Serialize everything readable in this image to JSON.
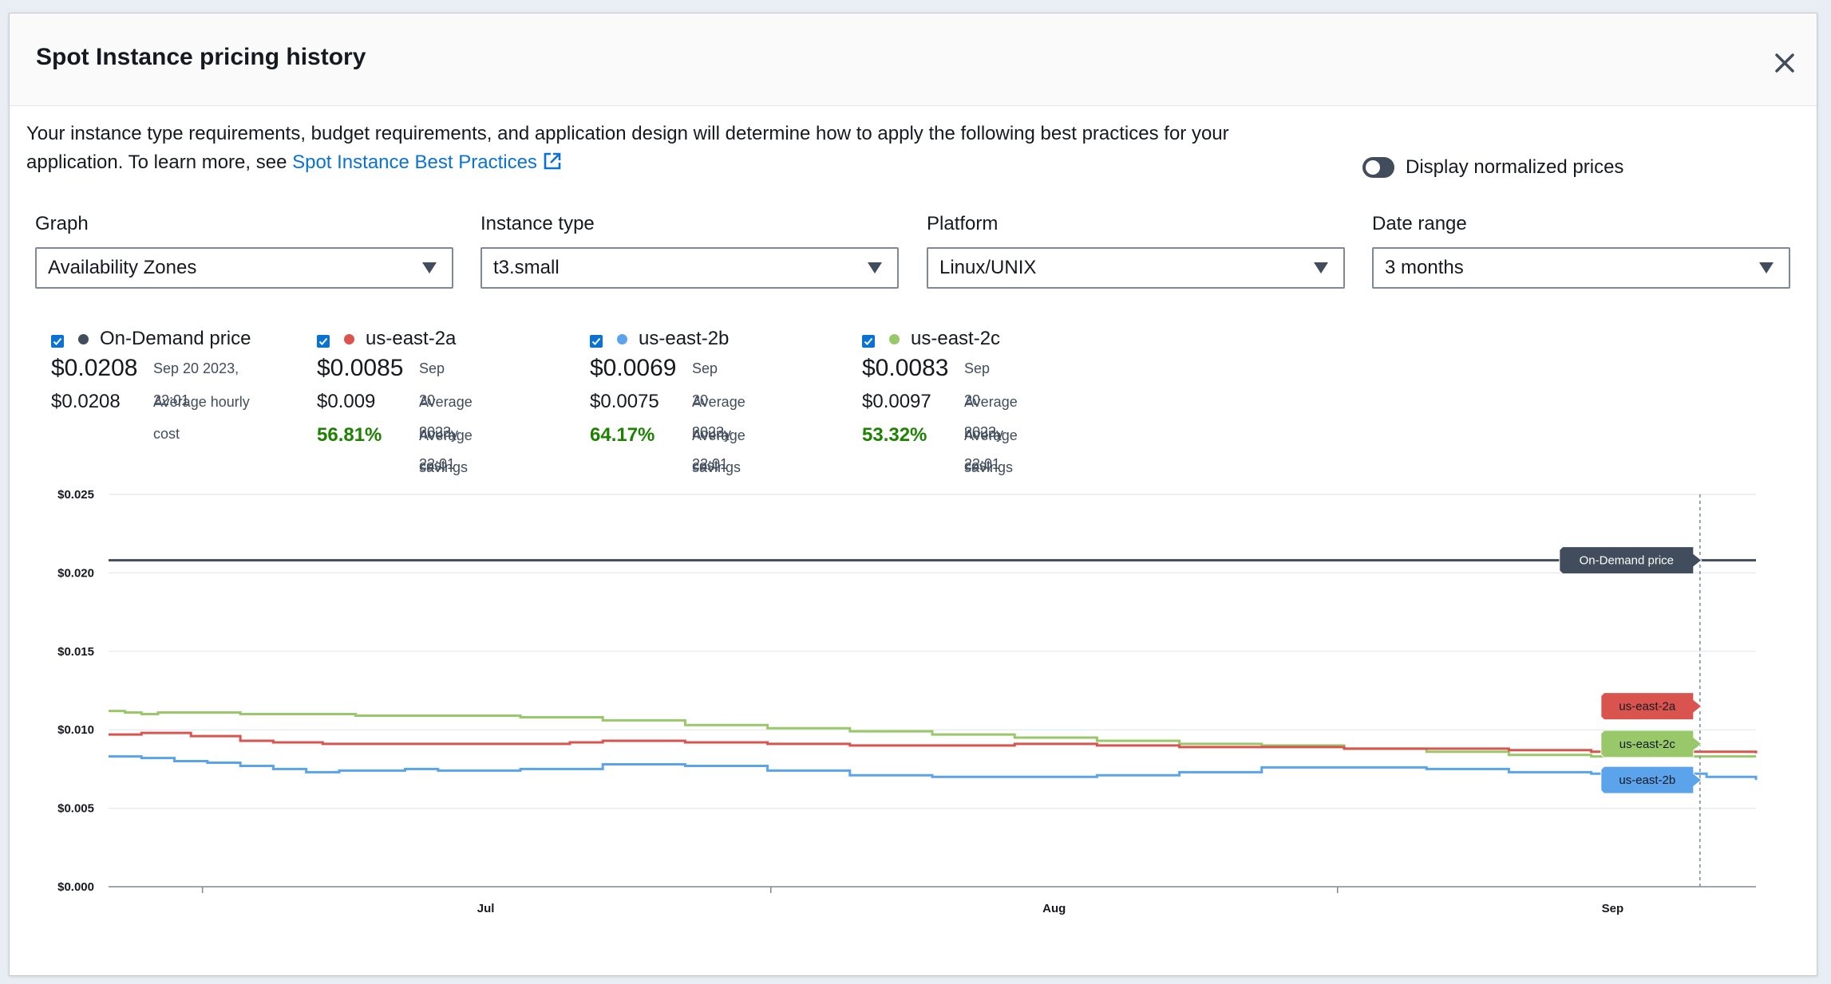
{
  "modal": {
    "title": "Spot Instance pricing history",
    "description": "Your instance type requirements, budget requirements, and application design will determine how to apply the following best practices for your application. To learn more, see ",
    "link_text": "Spot Instance Best Practices",
    "toggle_label": "Display normalized prices"
  },
  "filters": [
    {
      "label": "Graph",
      "value": "Availability Zones"
    },
    {
      "label": "Instance type",
      "value": "t3.small"
    },
    {
      "label": "Platform",
      "value": "Linux/UNIX"
    },
    {
      "label": "Date range",
      "value": "3 months"
    }
  ],
  "legend": [
    {
      "name": "On-Demand price",
      "color": "#414d5c",
      "current_price": "$0.0208",
      "timestamp": "Sep 20 2023, 22:01",
      "avg_cost": "$0.0208",
      "avg_cost_label": "Average hourly cost",
      "savings": "",
      "savings_label": ""
    },
    {
      "name": "us-east-2a",
      "color": "#d9534f",
      "current_price": "$0.0085",
      "timestamp": "Sep 20 2023, 22:01",
      "avg_cost": "$0.009",
      "avg_cost_label": "Average hourly cost",
      "savings": "56.81%",
      "savings_label": "Average savings"
    },
    {
      "name": "us-east-2b",
      "color": "#5ba3ea",
      "current_price": "$0.0069",
      "timestamp": "Sep 20 2023, 22:01",
      "avg_cost": "$0.0075",
      "avg_cost_label": "Average hourly cost",
      "savings": "64.17%",
      "savings_label": "Average savings"
    },
    {
      "name": "us-east-2c",
      "color": "#99c86a",
      "current_price": "$0.0083",
      "timestamp": "Sep 20 2023, 22:01",
      "avg_cost": "$0.0097",
      "avg_cost_label": "Average hourly cost",
      "savings": "53.32%",
      "savings_label": "Average savings"
    }
  ],
  "chart_data": {
    "type": "line",
    "ylim": [
      0,
      0.025
    ],
    "y_ticks": [
      0,
      0.005,
      0.01,
      0.015,
      0.02,
      0.025
    ],
    "y_tick_labels": [
      "$0.000",
      "$0.005",
      "$0.010",
      "$0.015",
      "$0.020",
      "$0.025"
    ],
    "x_tick_labels": [
      "Jul",
      "Aug",
      "Sep"
    ],
    "x_tick_positions": [
      0.229,
      0.574,
      0.913
    ],
    "x_minor_ticks": [
      0.057,
      0.402,
      0.746
    ],
    "grid": true,
    "hover_position": 0.966,
    "series": [
      {
        "name": "On-Demand price",
        "color": "#414d5c",
        "x": [
          0,
          1
        ],
        "y": [
          0.0208,
          0.0208
        ]
      },
      {
        "name": "us-east-2a",
        "color": "#d9534f",
        "x": [
          0,
          0.02,
          0.05,
          0.08,
          0.1,
          0.13,
          0.2,
          0.28,
          0.3,
          0.35,
          0.4,
          0.45,
          0.5,
          0.55,
          0.6,
          0.65,
          0.7,
          0.75,
          0.8,
          0.85,
          0.9,
          0.95,
          1
        ],
        "y": [
          0.0097,
          0.0098,
          0.0096,
          0.0093,
          0.0092,
          0.0091,
          0.0091,
          0.0092,
          0.0093,
          0.0092,
          0.0091,
          0.009,
          0.009,
          0.0091,
          0.009,
          0.0089,
          0.0089,
          0.0088,
          0.0088,
          0.0087,
          0.0086,
          0.0086,
          0.0085
        ]
      },
      {
        "name": "us-east-2b",
        "color": "#5ba3ea",
        "x": [
          0,
          0.02,
          0.04,
          0.06,
          0.08,
          0.1,
          0.12,
          0.14,
          0.16,
          0.18,
          0.2,
          0.25,
          0.3,
          0.35,
          0.4,
          0.45,
          0.5,
          0.55,
          0.6,
          0.65,
          0.7,
          0.75,
          0.8,
          0.85,
          0.9,
          0.95,
          0.97,
          1
        ],
        "y": [
          0.0083,
          0.0082,
          0.008,
          0.0079,
          0.0077,
          0.0075,
          0.0073,
          0.0074,
          0.0074,
          0.0075,
          0.0074,
          0.0075,
          0.0078,
          0.0077,
          0.0074,
          0.0071,
          0.007,
          0.007,
          0.0071,
          0.0073,
          0.0076,
          0.0076,
          0.0075,
          0.0073,
          0.0072,
          0.0072,
          0.007,
          0.0068
        ]
      },
      {
        "name": "us-east-2c",
        "color": "#99c86a",
        "x": [
          0,
          0.01,
          0.02,
          0.03,
          0.05,
          0.08,
          0.1,
          0.15,
          0.2,
          0.25,
          0.3,
          0.35,
          0.4,
          0.45,
          0.5,
          0.55,
          0.6,
          0.65,
          0.7,
          0.75,
          0.8,
          0.85,
          0.9,
          0.95,
          1
        ],
        "y": [
          0.0112,
          0.0111,
          0.011,
          0.0111,
          0.0111,
          0.011,
          0.011,
          0.0109,
          0.0109,
          0.0108,
          0.0106,
          0.0103,
          0.0101,
          0.0099,
          0.0097,
          0.0095,
          0.0093,
          0.0091,
          0.009,
          0.0088,
          0.0086,
          0.0084,
          0.0083,
          0.0083,
          0.0083
        ]
      }
    ],
    "tags": [
      {
        "label": "On-Demand price",
        "value": 0.0208
      },
      {
        "label": "us-east-2a",
        "value": 0.0115
      },
      {
        "label": "us-east-2c",
        "value": 0.0091
      },
      {
        "label": "us-east-2b",
        "value": 0.0068
      }
    ]
  }
}
